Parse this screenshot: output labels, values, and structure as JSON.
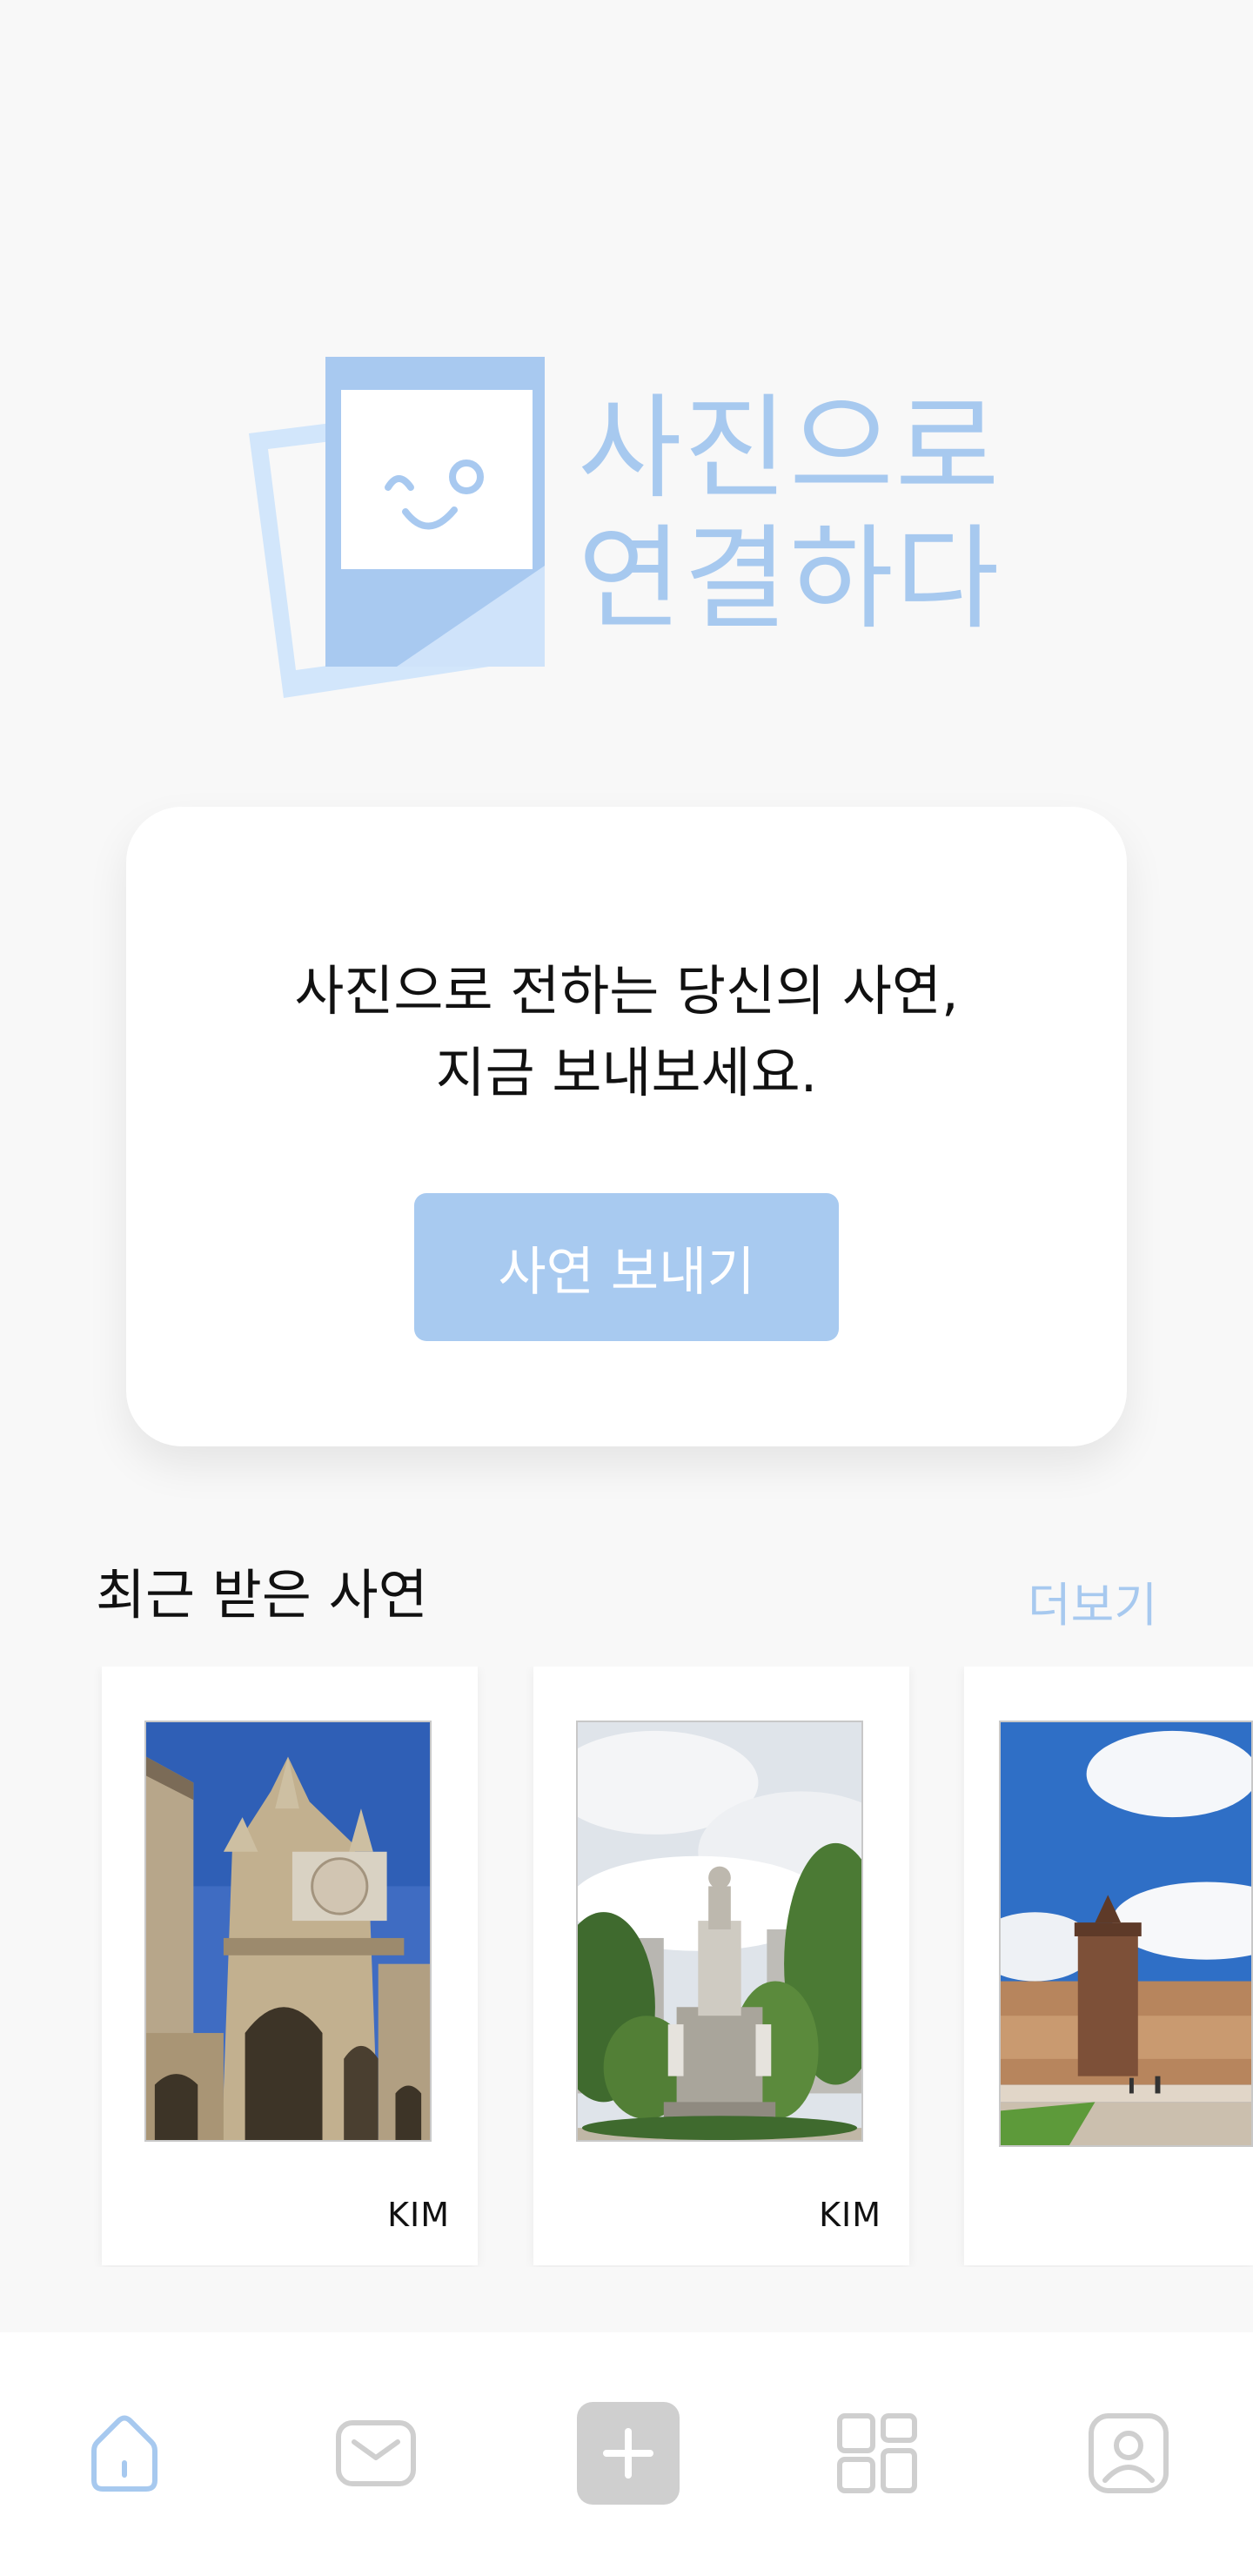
{
  "brand": {
    "line1": "사진으로",
    "line2": "연결하다",
    "accent_color": "#a7c9ef"
  },
  "card": {
    "message_line1": "사진으로 전하는 당신의 사연,",
    "message_line2": "지금 보내보세요.",
    "button_label": "사연 보내기",
    "button_color": "#a8caf0"
  },
  "recent": {
    "title": "최근 받은 사연",
    "more_label": "더보기",
    "items": [
      {
        "sender": "KIM",
        "photo": "gothic-chapel-courtyard"
      },
      {
        "sender": "KIM",
        "photo": "statue-monument-park"
      },
      {
        "sender": "",
        "photo": "castle-tower-blue-sky"
      }
    ]
  },
  "nav": {
    "items": [
      {
        "name": "home-icon",
        "active": true
      },
      {
        "name": "mail-icon",
        "active": false
      },
      {
        "name": "add-icon",
        "active": false
      },
      {
        "name": "grid-icon",
        "active": false
      },
      {
        "name": "profile-icon",
        "active": false
      }
    ],
    "active_color": "#a7c9ef",
    "inactive_color": "#cfcfcf"
  }
}
